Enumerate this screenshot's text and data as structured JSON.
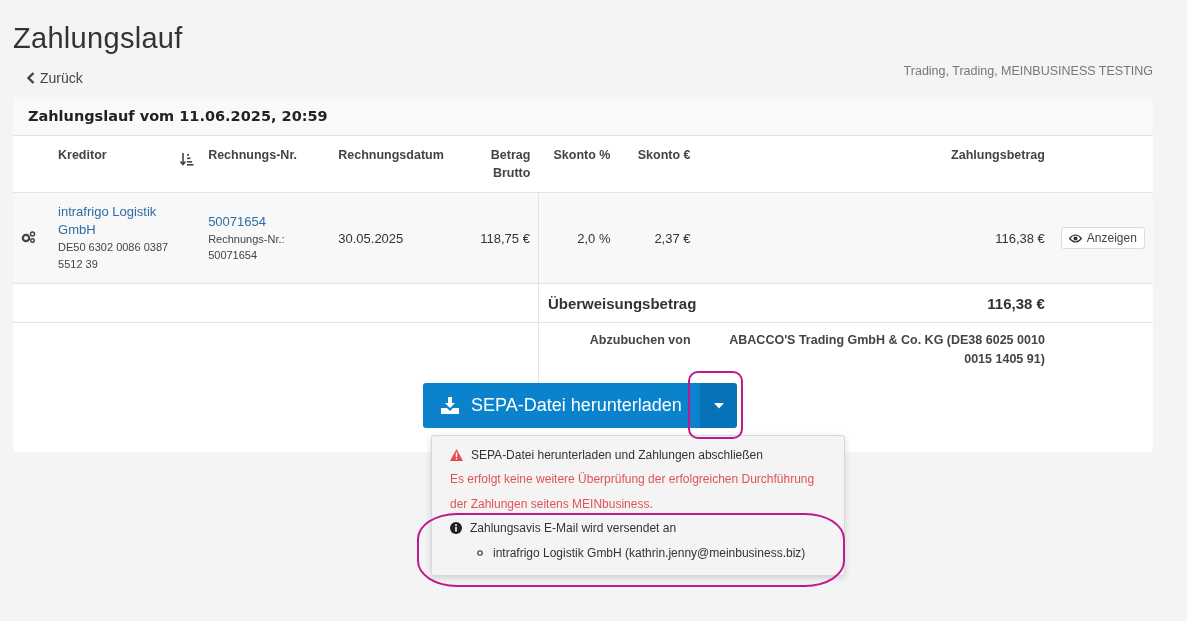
{
  "page": {
    "title": "Zahlungslauf",
    "back_link": "Zurück",
    "company": "Trading, Trading, MEINBUSINESS TESTING"
  },
  "card": {
    "title": "Zahlungslauf vom 11.06.2025, 20:59",
    "columns": [
      "Kreditor",
      "Rechnungs-Nr.",
      "Rechnungsdatum",
      "Betrag Brutto",
      "Skonto %",
      "Skonto €",
      "Zahlungsbetrag"
    ],
    "rows": [
      {
        "creditor": "intrafrigo Logistik GmbH",
        "iban": "DE50 6302 0086 0387 5512 39",
        "invoice_no": "50071654",
        "invoice_label": "Rechnungs-Nr.:",
        "invoice_ref": "50071654",
        "date": "30.05.2025",
        "gross": "118,75 €",
        "discount_pct": "2,0 %",
        "discount_eur": "2,37 €",
        "payment": "116,38 €",
        "action": "Anzeigen"
      }
    ],
    "summary": {
      "transfer_label": "Überweisungsbetrag",
      "transfer_amount": "116,38 €",
      "debit_label": "Abzubuchen von",
      "debit_account": "ABACCO'S Trading GmbH & Co. KG (DE38 6025 0010 0015 1405 91)"
    }
  },
  "split_button": {
    "label": "SEPA-Datei herunterladen",
    "expanded": true
  },
  "dropdown": {
    "warning_title": "SEPA-Datei herunterladen und Zahlungen abschließen",
    "warning_text": "Es erfolgt keine weitere Überprüfung der erfolgreichen Durchführung der Zahlungen seitens MEINbusiness.",
    "info_title": "Zahlungsavis E-Mail wird versendet an",
    "recipients": [
      "intrafrigo Logistik GmbH (kathrin.jenny@meinbusiness.biz)"
    ]
  }
}
